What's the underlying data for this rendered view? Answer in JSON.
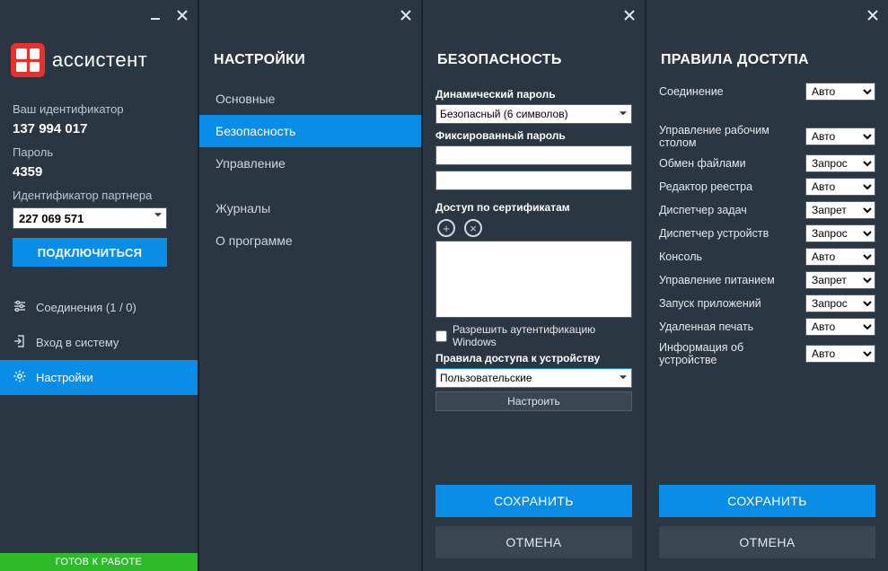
{
  "main": {
    "app_name": "ассистент",
    "your_id_label": "Ваш идентификатор",
    "your_id_value": "137 994 017",
    "password_label": "Пароль",
    "password_value": "4359",
    "partner_id_label": "Идентификатор партнера",
    "partner_id_value": "227 069 571",
    "connect_button": "ПОДКЛЮЧИТЬСЯ",
    "menu": {
      "connections": "Соединения (1 / 0)",
      "login": "Вход в систему",
      "settings": "Настройки"
    },
    "status": "ГОТОВ К РАБОТЕ"
  },
  "settings": {
    "title": "НАСТРОЙКИ",
    "items": {
      "general": "Основные",
      "security": "Безопасность",
      "control": "Управление",
      "logs": "Журналы",
      "about": "О программе"
    }
  },
  "security": {
    "title": "БЕЗОПАСНОСТЬ",
    "dyn_pw_label": "Динамический пароль",
    "dyn_pw_value": "Безопасный (6 символов)",
    "fixed_pw_label": "Фиксированный пароль",
    "fixed_pw_value1": "",
    "fixed_pw_value2": "",
    "cert_label": "Доступ по сертификатам",
    "win_auth_label": "Разрешить аутентификацию Windows",
    "device_rules_label": "Правила доступа к устройству",
    "device_rules_value": "Пользовательские",
    "configure_button": "Настроить",
    "save_button": "СОХРАНИТЬ",
    "cancel_button": "ОТМЕНА"
  },
  "rules": {
    "title": "ПРАВИЛА ДОСТУПА",
    "options": {
      "auto": "Авто",
      "request": "Запрос",
      "deny": "Запрет"
    },
    "rows": [
      {
        "label": "Соединение",
        "value": "Авто"
      },
      {
        "label": "Управление рабочим столом",
        "value": "Авто"
      },
      {
        "label": "Обмен файлами",
        "value": "Запрос"
      },
      {
        "label": "Редактор реестра",
        "value": "Авто"
      },
      {
        "label": "Диспетчер задач",
        "value": "Запрет"
      },
      {
        "label": "Диспетчер устройств",
        "value": "Запрос"
      },
      {
        "label": "Консоль",
        "value": "Авто"
      },
      {
        "label": "Управление питанием",
        "value": "Запрет"
      },
      {
        "label": "Запуск приложений",
        "value": "Запрос"
      },
      {
        "label": "Удаленная печать",
        "value": "Авто"
      },
      {
        "label": "Информация об устройстве",
        "value": "Авто"
      }
    ],
    "save_button": "СОХРАНИТЬ",
    "cancel_button": "ОТМЕНА"
  }
}
